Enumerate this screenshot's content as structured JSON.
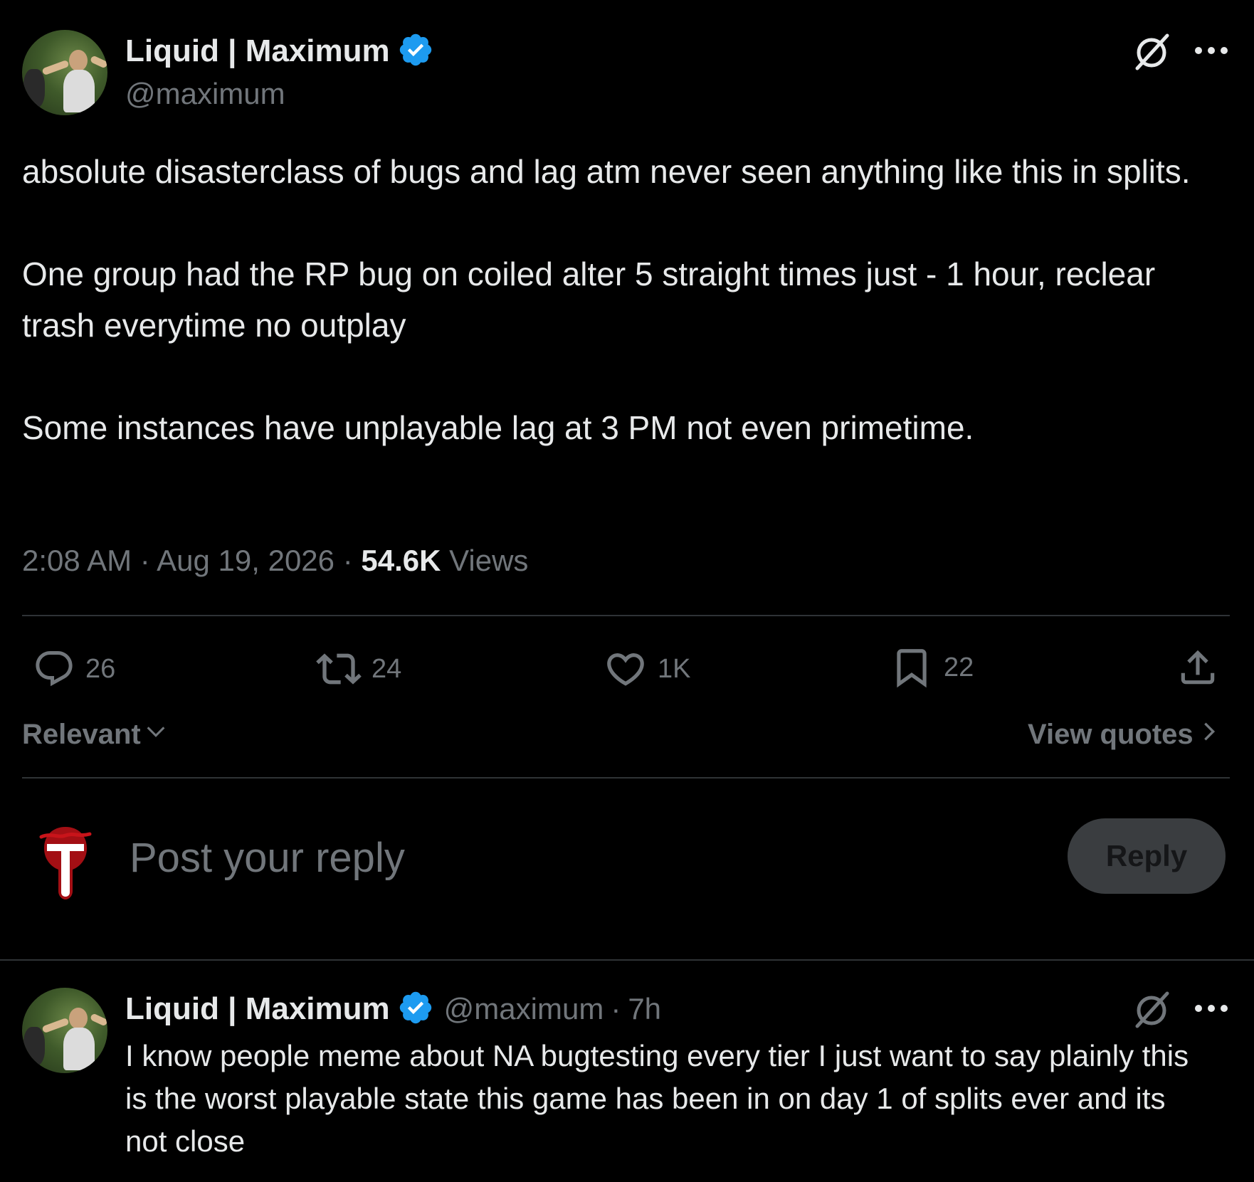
{
  "tweet": {
    "author": {
      "display_name": "Liquid | Maximum",
      "handle": "@maximum",
      "verified": true
    },
    "text": "absolute disasterclass of bugs and lag atm never seen anything like this in splits.\n\nOne group had the RP bug on coiled alter 5 straight times just - 1 hour, reclear trash everytime no outplay\n\nSome instances have unplayable lag at 3 PM not even primetime.",
    "time": "2:08 AM",
    "separator": "·",
    "date": "Aug 19, 2026",
    "views_count": "54.6K",
    "views_label": "Views",
    "actions": {
      "replies": "26",
      "reposts": "24",
      "likes": "1K",
      "bookmarks": "22"
    }
  },
  "sort": {
    "label": "Relevant",
    "view_quotes_label": "View quotes"
  },
  "composer": {
    "placeholder": "Post your reply",
    "button_label": "Reply"
  },
  "reply": {
    "author": {
      "display_name": "Liquid | Maximum",
      "handle": "@maximum",
      "verified": true
    },
    "separator": "·",
    "time_ago": "7h",
    "text": "I know people meme about NA bugtesting every tier I just want to say plainly this is the worst playable state this game has been in on day 1 of splits ever and its not close"
  },
  "icons": {
    "verified": "verified-badge-icon",
    "grok": "grok-icon",
    "more": "more-icon",
    "reply": "reply-icon",
    "repost": "repost-icon",
    "like": "like-icon",
    "bookmark": "bookmark-icon",
    "share": "share-icon",
    "chevron_down": "chevron-down-icon",
    "chevron_right": "chevron-right-icon"
  },
  "colors": {
    "background": "#000000",
    "text_primary": "#e7e9ea",
    "text_secondary": "#71767b",
    "verified_blue": "#1d9bf0",
    "divider": "#2f3336",
    "reply_button_bg": "#3a3d40"
  }
}
